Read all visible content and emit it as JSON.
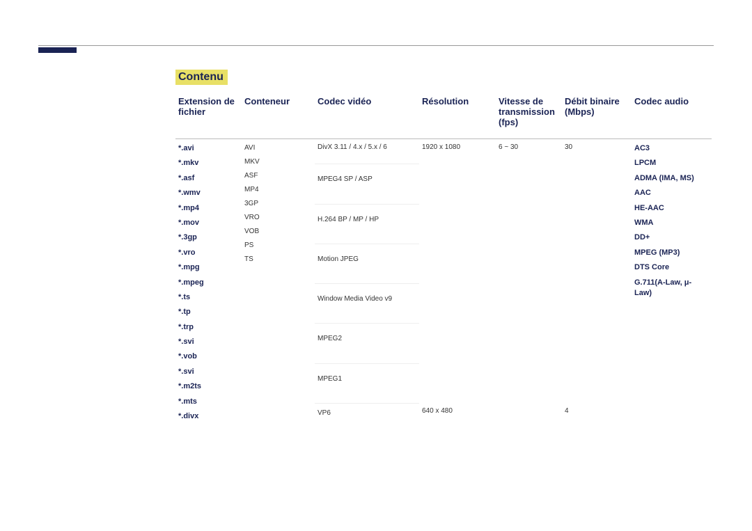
{
  "title": "Contenu",
  "headers": {
    "ext": "Extension de fichier",
    "cont": "Conteneur",
    "vc": "Codec vidéo",
    "res": "Résolution",
    "fps": "Vitesse de transmission (fps)",
    "mbps": "Débit binaire (Mbps)",
    "ac": "Codec audio"
  },
  "chart_data": {
    "type": "table",
    "title": "Codec and format support",
    "columns": [
      "Extension de fichier",
      "Conteneur",
      "Codec vidéo",
      "Résolution",
      "Vitesse de transmission (fps)",
      "Débit binaire (Mbps)",
      "Codec audio"
    ],
    "extensions": [
      "*.avi",
      "*.mkv",
      "*.asf",
      "*.wmv",
      "*.mp4",
      "*.mov",
      "*.3gp",
      "*.vro",
      "*.mpg",
      "*.mpeg",
      "*.ts",
      "*.tp",
      "*.trp",
      "*.svi",
      "*.vob",
      "*.svi",
      "*.m2ts",
      "*.mts",
      "*.divx"
    ],
    "containers": [
      "AVI",
      "MKV",
      "ASF",
      "MP4",
      "3GP",
      "VRO",
      "VOB",
      "PS",
      "TS"
    ],
    "video_codecs": [
      {
        "name": "DivX 3.11 / 4.x / 5.x / 6",
        "resolution": "1920 x 1080",
        "fps": "6 ~ 30",
        "mbps": "30"
      },
      {
        "name": "MPEG4 SP / ASP",
        "resolution": "1920 x 1080",
        "fps": "6 ~ 30",
        "mbps": "30"
      },
      {
        "name": "H.264 BP / MP / HP",
        "resolution": "1920 x 1080",
        "fps": "6 ~ 30",
        "mbps": "30"
      },
      {
        "name": "Motion JPEG",
        "resolution": "1920 x 1080",
        "fps": "6 ~ 30",
        "mbps": "30"
      },
      {
        "name": "Window Media Video v9",
        "resolution": "1920 x 1080",
        "fps": "6 ~ 30",
        "mbps": "30"
      },
      {
        "name": "MPEG2",
        "resolution": "1920 x 1080",
        "fps": "6 ~ 30",
        "mbps": "30"
      },
      {
        "name": "MPEG1",
        "resolution": "1920 x 1080",
        "fps": "6 ~ 30",
        "mbps": "30"
      },
      {
        "name": "VP6",
        "resolution": "640 x 480",
        "fps": "6 ~ 30",
        "mbps": "4"
      }
    ],
    "audio_codecs": [
      "AC3",
      "LPCM",
      "ADMA (IMA, MS)",
      "AAC",
      "HE-AAC",
      "WMA",
      "DD+",
      "MPEG (MP3)",
      "DTS Core",
      "G.711(A-Law, μ-Law)"
    ]
  },
  "ext": {
    "r0": "*.avi",
    "r1": "*.mkv",
    "r2": "*.asf",
    "r3": "*.wmv",
    "r4": "*.mp4",
    "r5": "*.mov",
    "r6": "*.3gp",
    "r7": "*.vro",
    "r8": "*.mpg",
    "r9": "*.mpeg",
    "r10": "*.ts",
    "r11": "*.tp",
    "r12": "*.trp",
    "r13": "*.svi",
    "r14": "*.vob",
    "r15": "*.svi",
    "r16": "*.m2ts",
    "r17": "*.mts",
    "r18": "*.divx"
  },
  "cont": {
    "r0": "AVI",
    "r1": "MKV",
    "r2": "ASF",
    "r3": "MP4",
    "r4": "3GP",
    "r5": "VRO",
    "r6": "VOB",
    "r7": "PS",
    "r8": "TS"
  },
  "vc": {
    "r0": "DivX 3.11 / 4.x / 5.x / 6",
    "r1": "MPEG4 SP / ASP",
    "r2": "H.264 BP / MP / HP",
    "r3": "Motion JPEG",
    "r4": "Window Media Video v9",
    "r5": "MPEG2",
    "r6": "MPEG1",
    "r7": "VP6"
  },
  "res": {
    "r0": "1920 x 1080",
    "r1": "640 x 480"
  },
  "fps": {
    "r0": "6 ~ 30"
  },
  "mbps": {
    "r0": "30",
    "r1": "4"
  },
  "ac": {
    "r0": "AC3",
    "r1": "LPCM",
    "r2": "ADMA (IMA, MS)",
    "r3": "AAC",
    "r4": "HE-AAC",
    "r5": "WMA",
    "r6": "DD+",
    "r7": "MPEG (MP3)",
    "r8": "DTS Core",
    "r9": "G.711(A-Law, μ-Law)"
  }
}
